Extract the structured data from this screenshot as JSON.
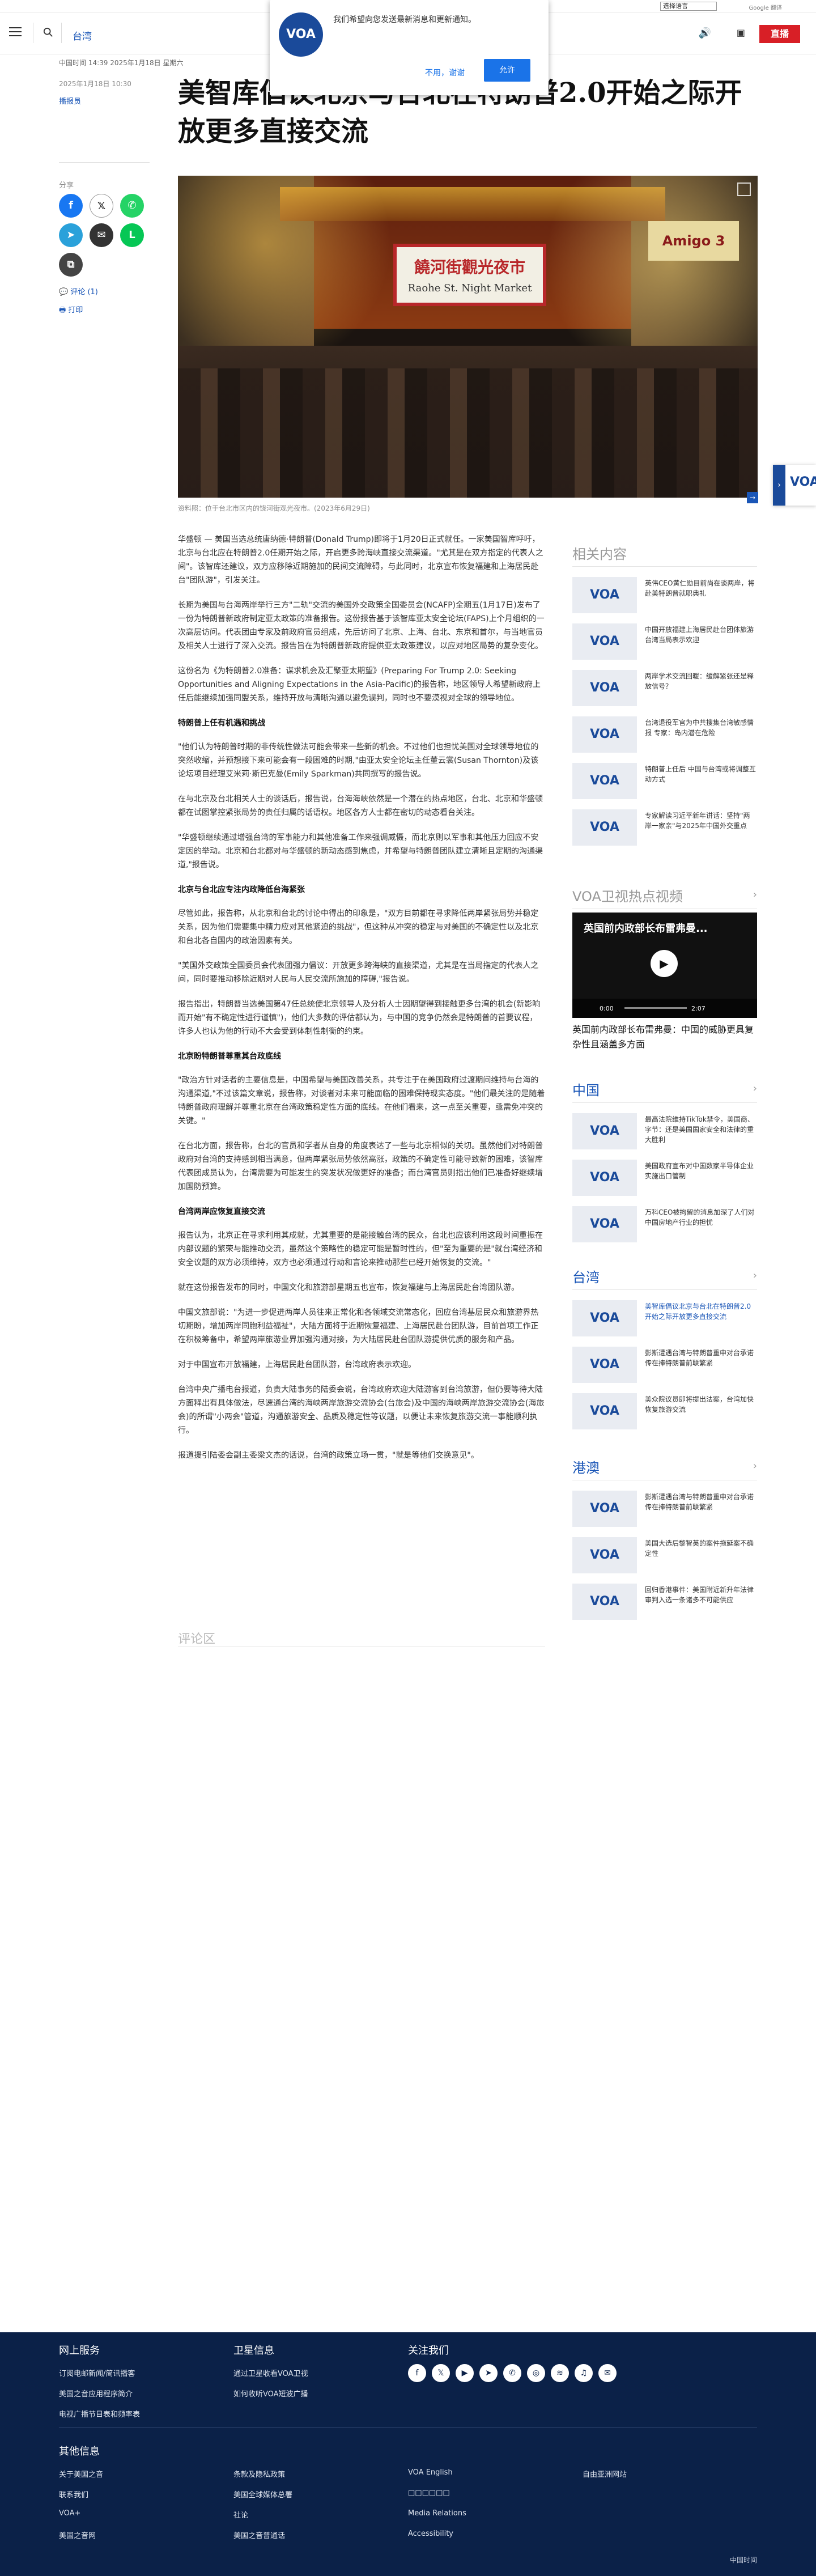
{
  "langbar": {
    "language_select": "选择语言",
    "powered": "Google 翻译"
  },
  "header": {
    "section": "台湾",
    "live_label": "直播"
  },
  "notification": {
    "logo": "VOA",
    "message": "我们希望向您发送最新消息和更新通知。",
    "deny": "不用，谢谢",
    "allow": "允许"
  },
  "article": {
    "meta": "中国时间 14:39 2025年1月18日 星期六",
    "date": "2025年1月18日 10:30",
    "author": "播报员",
    "title": "美智库倡议北京与台北在特朗普2.0开始之际开放更多直接交流",
    "share_label": "分享",
    "comments_link": "评论 (1)",
    "print_link": "打印",
    "image_sign_zh": "饒河街觀光夜市",
    "image_sign_en": "Raohe St. Night Market",
    "image_shop_sign": "Amigo 3",
    "caption": "资料照：位于台北市区内的饶河街观光夜市。(2023年6月29日)",
    "paragraphs": [
      "华盛顿 — 美国当选总统唐纳德·特朗普(Donald Trump)即将于1月20日正式就任。一家美国智库呼吁，北京与台北应在特朗普2.0任期开始之际，开启更多跨海峡直接交流渠道。\"尤其是在双方指定的代表人之间\"。该智库还建议，双方应移除近期施加的民间交流障碍，与此同时，北京宣布恢复福建和上海居民赴台\"团队游\"，引发关注。",
      "长期为美国与台海两岸举行三方\"二轨\"交流的美国外交政策全国委员会(NCAFP)全期五(1月17日)发布了一份为特朗普新政府制定亚太政策的准备报告。这份报告基于该智库亚太安全论坛(FAPS)上个月组织的一次高层访问。代表团由专家及前政府官员组成，先后访问了北京、上海、台北、东京和首尔，与当地官员及相关人士进行了深入交流。报告旨在为特朗普新政府提供亚太政策建议，以应对地区局势的复杂变化。",
      "这份名为《为特朗普2.0准备：谋求机会及汇聚亚太期望》(Preparing For Trump 2.0: Seeking Opportunities and Aligning Expectations in the Asia-Pacific)的报告称，地区领导人希望新政府上任后能继续加强同盟关系，维持开放与清晰沟通以避免误判，同时也不要漠视对全球的领导地位。",
      "\"他们认为特朗普时期的非传统性做法可能会带来一些新的机会。不过他们也担忧美国对全球领导地位的突然收缩，并预想接下来可能会有一段困难的时期,\"由亚太安全论坛主任董云裳(Susan Thornton)及该论坛项目经理艾米莉·斯巴克曼(Emily Sparkman)共同撰写的报告说。",
      "在与北京及台北相关人士的谈话后，报告说，台海海峡依然是一个潜在的热点地区，台北、北京和华盛顿都在试图掌控紧张局势的责任归属的话语权。地区各方人士都在密切的动态看台关注。",
      "\"华盛顿继续通过增强台湾的军事能力和其他准备工作来强调威慑，而北京则以军事和其他压力回应不安定因的举动。北京和台北都对与华盛顿的新动态感到焦虑，并希望与特朗普团队建立清晰且定期的沟通渠道,\"报告说。",
      "尽管如此，报告称，从北京和台北的讨论中得出的印象是，\"双方目前都在寻求降低两岸紧张局势并稳定关系，因为他们需要集中精力应对其他紧迫的挑战\"，但这种从冲突的稳定与对美国的不确定性以及北京和台北各自国内的政治因素有关。",
      "\"美国外交政策全国委员会代表团强力倡议：开放更多跨海峡的直接渠道，尤其是在当局指定的代表人之间，同时要推动移除近期对人民与人民交流所施加的障碍,\"报告说。",
      "报告指出，特朗普当选美国第47任总统使北京领导人及分析人士因期望得到接触更多台湾的机会(新影响而开始\"有不确定性进行谨慎\")，他们大多数的评估都认为，与中国的竞争仍然会是特朗普的首要议程，许多人也认为他的行动不大会受到体制性制衡的约束。",
      "\"政治方针对话者的主要信息是，中国希望与美国改善关系，共专注于在美国政府过渡期间维持与台海的沟通渠道,\"不过该篇文章说，报告称，对谈者对未来可能面临的困难保持现实态度。\"他们最关注的是随着特朗普政府理解并尊重北京在台湾政策稳定性方面的底线。在他们看来，这一点至关重要，亟需免冲突的关键。\"",
      "在台北方面，报告称，台北的官员和学者从自身的角度表达了一些与北京相似的关切。虽然他们对特朗普政府对台湾的支持感到相当满意，但两岸紧张局势依然高涨，政策的不确定性可能导致新的困难，该智库代表团成员认为，台湾需要为可能发生的突发状况做更好的准备；而台湾官员则指出他们已准备好继续增加国防预算。",
      "报告认为，北京正在寻求利用其成就，尤其重要的是能接触台湾的民众，台北也应该利用这段时间重振在内部议题的繁荣与能推动交流，虽然这个策略性的稳定可能是暂时性的，但\"至为重要的是\"就台湾经济和安全议题的双方必须维持，双方也必须通过行动和言论来推动那些已经开始恢复的交流。\"",
      "就在这份报告发布的同时，中国文化和旅游部星期五也宣布，恢复福建与上海居民赴台湾团队游。",
      "中国文旅部说：\"为进一步促进两岸人员往来正常化和各领域交流常态化，回应台湾基层民众和旅游界热切期盼，增加两岸同胞利益福祉\"，大陆方面将于近期恢复福建、上海居民赴台团队游，目前首项工作正在积极筹备中，希望两岸旅游业界加强沟通对接，为大陆居民赴台团队游提供优质的服务和产品。",
      "对于中国宣布开放福建，上海居民赴台团队游，台湾政府表示欢迎。",
      "台湾中央广播电台报道，负责大陆事务的陆委会说，台湾政府欢迎大陆游客到台湾旅游，但仍要等待大陆方面释出有具体做法，尽速通台湾的海峡两岸旅游交流协会(台旅会)及中国的海峡两岸旅游交流协会(海旅会)的所谓\"小两会\"管道，沟通旅游安全、品质及稳定性等议题，以便让未来恢复旅游交流一事能顺利执行。",
      "报道援引陆委会副主委梁文杰的话说，台湾的政策立场一贯，\"就是等他们交换意见\"。"
    ],
    "headings": [
      "特朗普上任有机遇和挑战",
      "北京与台北应专注内政降低台海紧张",
      "北京盼特朗普尊重其台政底线",
      "台湾两岸应恢复直接交流"
    ],
    "comments_title": "评论区"
  },
  "sidebar": {
    "related_title": "相关内容",
    "related": [
      "英伟CEO黄仁勋目前尚在谈两岸，将赴美特朗普就职典礼",
      "中国开放福建上海居民赴台团体旅游 台湾当局表示欢迎",
      "两岸学术交流回暖：缓解紧张还是释放信号？",
      "台湾退役军官为中共搜集台湾敏感情报 专家：岛内潜在危险",
      "特朗普上任后 中国与台湾或将调整互动方式",
      "专家解读习近平新年讲话：坚持\"两岸一家亲\"与2025年中国外交重点"
    ],
    "video_title": "VOA卫视热点视频",
    "video_overlay": "英国前内政部长布雷弗曼...",
    "video_time": "0:00",
    "video_duration": "2:07",
    "video_caption": "英国前内政部长布雷弗曼：中国的威胁更具复杂性且涵盖多方面",
    "china_title": "中国",
    "china": [
      "最高法院维持TikTok禁令，美国商、字节：还是美国国家安全和法律的重大胜利",
      "美国政府宣布对中国数家半导体企业实施出口管制",
      "万科CEO被拘留的消息加深了人们对中国房地产行业的担忧"
    ],
    "taiwan_title": "台湾",
    "taiwan": [
      "美智库倡议北京与台北在特朗普2.0开始之际开放更多直接交流",
      "彭斯遭遇台湾与特朗普重申对台承诺 传在捧特朗普前联繁紧",
      "美众院议员即将提出法案，台湾加快恢复旅游交流"
    ],
    "hk_title": "港澳",
    "hk": [
      "彭斯遭遇台湾与特朗普重申对台承诺 传在捧特朗普前联繁紧",
      "美国大选后黎智英的案件拖延案不确定性",
      "回归香港事件：美国附近新升年法律审判入选一条诸多不可能供应"
    ]
  },
  "footer": {
    "col1_title": "网上服务",
    "col1": [
      "订阅电邮新闻/简讯播客",
      "美国之音应用程序简介",
      "电视广播节目表和频率表"
    ],
    "col2_title": "卫星信息",
    "col2": [
      "通过卫星收看VOA卫视",
      "如何收听VOA短波广播"
    ],
    "col3_title": "关注我们",
    "social": [
      "facebook-icon",
      "x-icon",
      "youtube-icon",
      "telegram-icon",
      "whatsapp-icon",
      "instagram-icon",
      "rss-icon",
      "podcast-icon",
      "email-icon"
    ],
    "other_title": "其他信息",
    "other": [
      "关于美国之音",
      "联系我们",
      "VOA+",
      "美国之音网",
      "条款及隐私政策",
      "美国全球媒体总署",
      "社论",
      "美国之音普通话",
      "VOA English",
      "□□□□□□",
      "Media Relations",
      "Accessibility",
      "自由亚洲网站"
    ],
    "copyright": "中国时间"
  }
}
